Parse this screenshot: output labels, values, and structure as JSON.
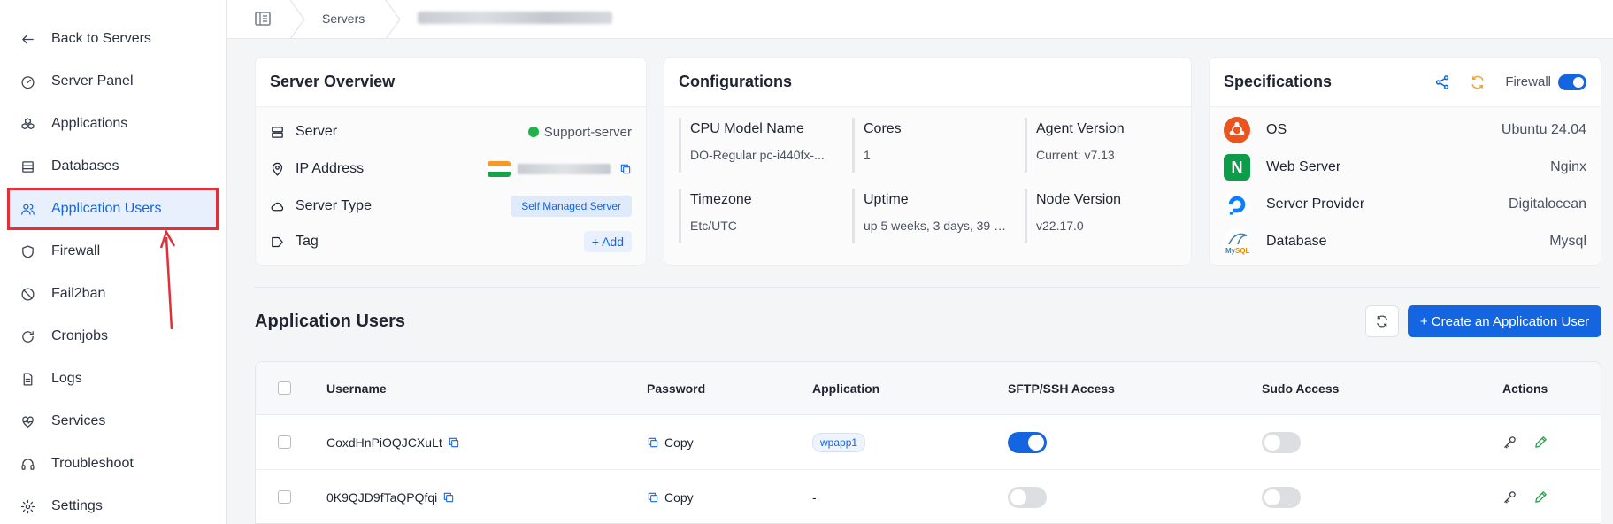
{
  "sidebar": {
    "items": [
      {
        "label": "Back to Servers",
        "icon": "arrow-left-icon"
      },
      {
        "label": "Server Panel",
        "icon": "gauge-icon"
      },
      {
        "label": "Applications",
        "icon": "cubes-icon"
      },
      {
        "label": "Databases",
        "icon": "database-icon"
      },
      {
        "label": "Application Users",
        "icon": "users-icon",
        "active": true
      },
      {
        "label": "Firewall",
        "icon": "shield-icon"
      },
      {
        "label": "Fail2ban",
        "icon": "ban-icon"
      },
      {
        "label": "Cronjobs",
        "icon": "cron-icon"
      },
      {
        "label": "Logs",
        "icon": "file-icon"
      },
      {
        "label": "Services",
        "icon": "heartbeat-icon"
      },
      {
        "label": "Troubleshoot",
        "icon": "headset-icon"
      },
      {
        "label": "Settings",
        "icon": "gear-icon"
      }
    ]
  },
  "breadcrumb": {
    "servers": "Servers"
  },
  "overview": {
    "title": "Server Overview",
    "server_label": "Server",
    "server_value": "Support-server",
    "ip_label": "IP Address",
    "type_label": "Server Type",
    "type_value": "Self Managed Server",
    "tag_label": "Tag",
    "tag_button": "+ Add"
  },
  "configurations": {
    "title": "Configurations",
    "items": [
      {
        "key": "CPU Model Name",
        "value": "DO-Regular pc-i440fx-..."
      },
      {
        "key": "Cores",
        "value": "1"
      },
      {
        "key": "Agent Version",
        "value": "Current: v7.13"
      },
      {
        "key": "Timezone",
        "value": "Etc/UTC"
      },
      {
        "key": "Uptime",
        "value": "up 5 weeks, 3 days, 39 m..."
      },
      {
        "key": "Node Version",
        "value": "v22.17.0"
      }
    ]
  },
  "specifications": {
    "title": "Specifications",
    "firewall_label": "Firewall",
    "firewall_on": true,
    "items": [
      {
        "key": "OS",
        "value": "Ubuntu 24.04",
        "icon": "ubuntu-icon"
      },
      {
        "key": "Web Server",
        "value": "Nginx",
        "icon": "nginx-icon"
      },
      {
        "key": "Server Provider",
        "value": "Digitalocean",
        "icon": "digitalocean-icon"
      },
      {
        "key": "Database",
        "value": "Mysql",
        "icon": "mysql-icon"
      }
    ]
  },
  "users_section": {
    "title": "Application Users",
    "create_button": "+ Create an Application User",
    "columns": [
      "Username",
      "Password",
      "Application",
      "SFTP/SSH Access",
      "Sudo Access",
      "Actions"
    ],
    "rows": [
      {
        "username": "CoxdHnPiOQJCXuLt",
        "password": "Copy",
        "application": "wpapp1",
        "sftp": true,
        "sudo": false
      },
      {
        "username": "0K9QJD9fTaQPQfqi",
        "password": "Copy",
        "application": "-",
        "sftp": false,
        "sudo": false
      }
    ]
  },
  "colors": {
    "accent": "#1565e0",
    "highlight": "#e0313a",
    "online": "#22b24c"
  }
}
